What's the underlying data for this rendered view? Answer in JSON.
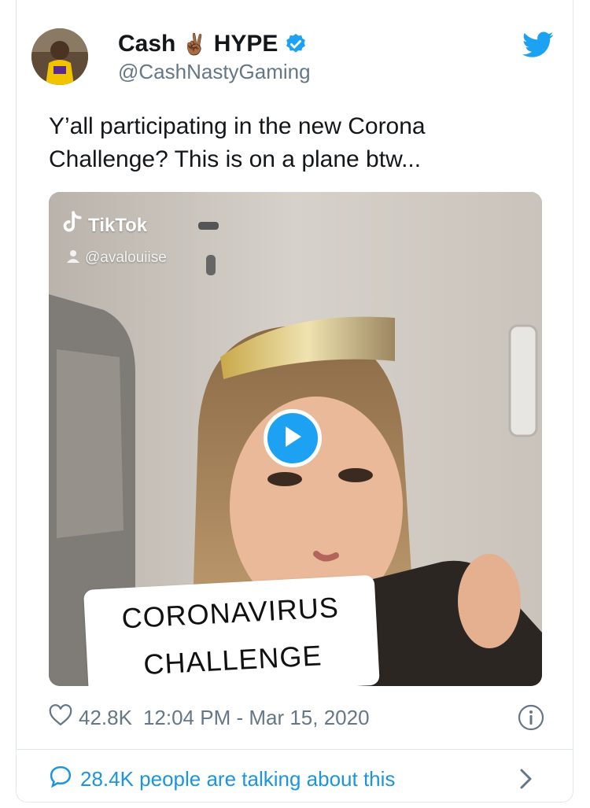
{
  "tweet": {
    "display_name_part1": "Cash",
    "display_name_emoji": "✌🏾",
    "display_name_part2": "HYPE",
    "verified": true,
    "handle": "@CashNastyGaming",
    "text_line1": "Y’all participating in the new Corona",
    "text_line2": "Challenge? This is on a plane btw...",
    "likes": "42.8K",
    "timestamp": "12:04 PM - Mar 15, 2020",
    "talking": "28.4K people are talking about this"
  },
  "media": {
    "brand": "TikTok",
    "username": "@avalouiise",
    "caption_line1": "CORONAVIRUS",
    "caption_line2": "CHALLENGE"
  },
  "colors": {
    "accent": "#1da1f2",
    "link": "#1b95e0",
    "muted": "#657786",
    "text": "#14171a"
  },
  "icons": [
    "twitter-bird-icon",
    "verified-badge-icon",
    "play-icon",
    "heart-icon",
    "info-icon",
    "speech-bubble-icon",
    "chevron-right-icon",
    "tiktok-logo-icon",
    "user-icon"
  ]
}
